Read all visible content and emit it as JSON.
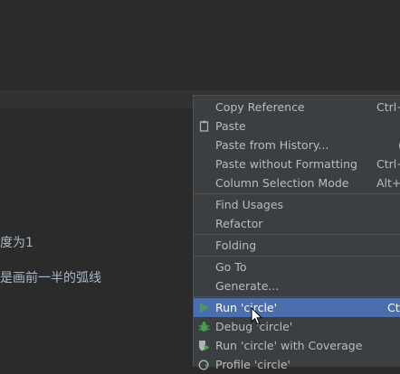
{
  "editor": {
    "line1": "度为1",
    "line2": "是画前一半的弧线"
  },
  "menu": {
    "copy_reference": {
      "label": "Copy Reference",
      "shortcut": "Ctrl+"
    },
    "paste": {
      "label": "Paste",
      "shortcut": ""
    },
    "paste_from_history": {
      "label": "Paste from History...",
      "shortcut": "("
    },
    "paste_without_formatting": {
      "label": "Paste without Formatting",
      "shortcut": "Ctrl+"
    },
    "column_selection_mode": {
      "label": "Column Selection Mode",
      "shortcut": "Alt+"
    },
    "find_usages": {
      "label": "Find Usages"
    },
    "refactor": {
      "label": "Refactor"
    },
    "folding": {
      "label": "Folding"
    },
    "go_to": {
      "label": "Go To"
    },
    "generate": {
      "label": "Generate..."
    },
    "run": {
      "label": "Run 'circle'",
      "shortcut": "Ctr"
    },
    "debug": {
      "label": "Debug 'circle'"
    },
    "run_coverage": {
      "label": "Run 'circle' with Coverage"
    },
    "profile": {
      "label": "Profile 'circle'"
    }
  },
  "icons": {
    "paste": "clipboard-icon",
    "run": "play-icon",
    "debug": "bug-icon",
    "coverage": "shield-run-icon",
    "profile": "profile-icon",
    "cursor": "mouse-cursor-icon"
  },
  "colors": {
    "background": "#2b2b2b",
    "menu_background": "#3c3f41",
    "selected": "#4b6eaf",
    "run_green": "#499c54"
  }
}
